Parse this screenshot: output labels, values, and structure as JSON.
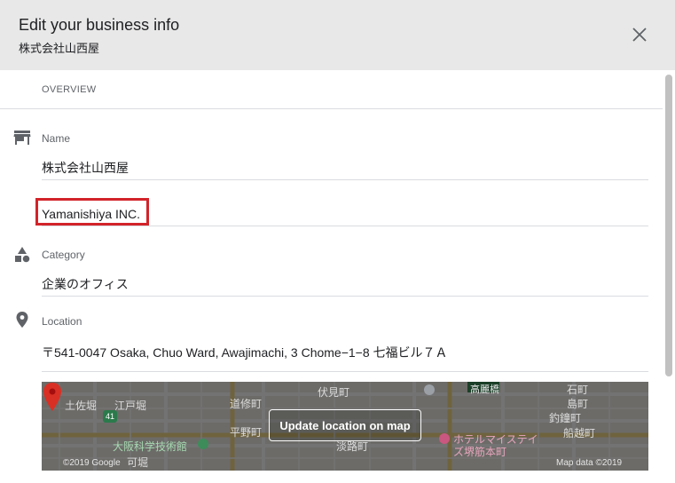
{
  "dialog": {
    "title": "Edit your business info",
    "subtitle": "株式会社山西屋"
  },
  "overview": {
    "section_label": "OVERVIEW"
  },
  "name_field": {
    "label": "Name",
    "value": "株式会社山西屋",
    "alt_value": "Yamanishiya INC."
  },
  "category_field": {
    "label": "Category",
    "value": "企業のオフィス"
  },
  "location_field": {
    "label": "Location",
    "address": "〒541-0047 Osaka, Chuo Ward, Awajimachi, 3 Chome−1−8 七福ビル７Ａ"
  },
  "map": {
    "update_button": "Update location on map",
    "copyright": "©2019 Google",
    "map_data": "Map data ©2019",
    "labels": {
      "tosabori": "土佐堀",
      "edobori": "江戸堀",
      "route_badge": "41",
      "doshumachi": "道修町",
      "fushimimachi": "伏見町",
      "koraibashi": "高麗橋",
      "ishimachi": "石町",
      "shimamachi": "島町",
      "tsuriganecho": "釣鐘町",
      "funakoshicho": "船越町",
      "hiranomachi": "平野町",
      "awajimachi": "淡路町",
      "museum": "大阪科学技術館",
      "kitabori": "可堀",
      "hotel_line1": "ホテルマイステイ",
      "hotel_line2": "ズ堺筋本町"
    }
  },
  "icons": {
    "close": "close-icon",
    "store": "store-icon",
    "category": "category-shapes-icon",
    "location": "location-pin-icon"
  },
  "colors": {
    "header_bg": "#e8e8e8",
    "highlight": "#d2232a",
    "icon": "#5f6368",
    "pin": "#d93025"
  }
}
